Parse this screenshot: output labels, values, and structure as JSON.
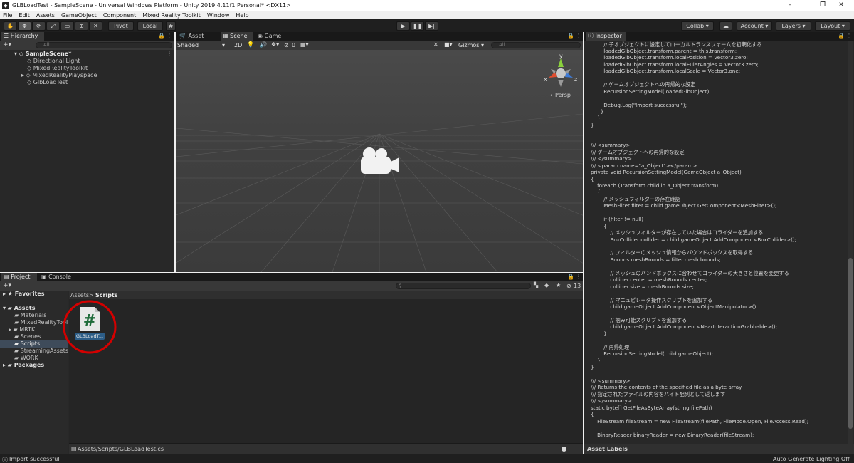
{
  "window": {
    "title": "GLBLoadTest - SampleScene - Universal Windows Platform - Unity 2019.4.11f1 Personal* <DX11>",
    "minimize": "–",
    "maximize": "❐",
    "close": "✕"
  },
  "menu": [
    "File",
    "Edit",
    "Assets",
    "GameObject",
    "Component",
    "Mixed Reality Toolkit",
    "Window",
    "Help"
  ],
  "toolbar": {
    "pivot": "Pivot",
    "local": "Local",
    "collab": "Collab",
    "account": "Account",
    "layers": "Layers",
    "layout": "Layout"
  },
  "hierarchy": {
    "tab": "Hierarchy",
    "search_placeholder": "All",
    "items": [
      "SampleScene*",
      "Directional Light",
      "MixedRealityToolkit",
      "MixedRealityPlayspace",
      "GlbLoadTest"
    ]
  },
  "scene": {
    "tabs": [
      "Asset Store",
      "Scene",
      "Game"
    ],
    "shaded": "Shaded",
    "mode2d": "2D",
    "fx_count": "0",
    "gizmos": "Gizmos",
    "search_placeholder": "All",
    "persp": "Persp",
    "axis_x": "x",
    "axis_y": "y",
    "axis_z": "z"
  },
  "project": {
    "tabs": [
      "Project",
      "Console"
    ],
    "favorites": "Favorites",
    "assets_root": "Assets",
    "folders": [
      "Materials",
      "MixedRealityToolkit",
      "MRTK",
      "Scenes",
      "Scripts",
      "StreamingAssets",
      "WORK"
    ],
    "packages": "Packages",
    "breadcrumb_root": "Assets",
    "breadcrumb_sep": ">",
    "breadcrumb_current": "Scripts",
    "item_count": "13",
    "asset_label": "GLBLoadT...",
    "asset_glyph": "#",
    "selected_path": "Assets/Scripts/GLBLoadTest.cs"
  },
  "inspector": {
    "tab": "Inspector",
    "code": [
      "        // 子オブジェクトに設定してローカルトランスフォームを初期化する",
      "        loadedGlbObject.transform.parent = this.transform;",
      "        loadedGlbObject.transform.localPosition = Vector3.zero;",
      "        loadedGlbObject.transform.localEulerAngles = Vector3.zero;",
      "        loadedGlbObject.transform.localScale = Vector3.one;",
      "",
      "        // ゲームオブジェクトへの再帰的な設定",
      "        RecursionSettingModel(loadedGlbObject);",
      "",
      "        Debug.Log(\"Import successful\");",
      "      }",
      "    }",
      "}",
      "",
      "",
      "/// <summary>",
      "/// ゲームオブジェクトへの再帰的な設定",
      "/// </summary>",
      "/// <param name=\"a_Object\"></param>",
      "private void RecursionSettingModel(GameObject a_Object)",
      "{",
      "    foreach (Transform child in a_Object.transform)",
      "    {",
      "        // メッシュフィルターの存在確認",
      "        MeshFilter filter = child.gameObject.GetComponent<MeshFilter>();",
      "",
      "        if (filter != null)",
      "        {",
      "            // メッシュフィルターが存在していた場合はコライダーを追加する",
      "            BoxCollider collider = child.gameObject.AddComponent<BoxCollider>();",
      "",
      "            // フィルターのメッシュ情報からバウンドボックスを取得する",
      "            Bounds meshBounds = filter.mesh.bounds;",
      "",
      "            // メッシュのバンドボックスに合わせてコライダーの大きさと位置を変更する",
      "            collider.center = meshBounds.center;",
      "            collider.size = meshBounds.size;",
      "",
      "            // マニュピレータ操作スクリプトを追加する",
      "            child.gameObject.AddComponent<ObjectManipulator>();",
      "",
      "            // 掴み可能スクリプトを追加する",
      "            child.gameObject.AddComponent<NearInteractionGrabbable>();",
      "        }",
      "",
      "        // 再帰処理",
      "        RecursionSettingModel(child.gameObject);",
      "    }",
      "}",
      "",
      "/// <summary>",
      "/// Returns the contents of the specified file as a byte array.",
      "/// 指定されたファイルの内容をバイト配列として返します",
      "/// </summary>",
      "static byte[] GetFileAsByteArray(string filePath)",
      "{",
      "    FileStream fileStream = new FileStream(filePath, FileMode.Open, FileAccess.Read);",
      "",
      "    BinaryReader binaryReader = new BinaryReader(fileStream);"
    ],
    "asset_labels": "Asset Labels"
  },
  "status": {
    "message": "Import successful",
    "right": "Auto Generate Lighting Off"
  },
  "colors": {
    "highlight_circle": "#d40000",
    "selection": "#2c5d87"
  }
}
